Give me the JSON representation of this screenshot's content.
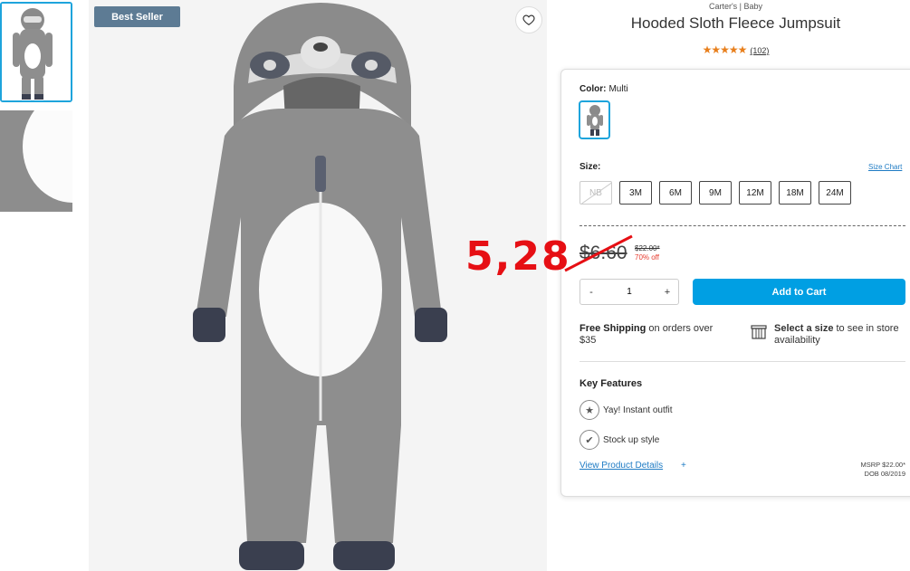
{
  "gallery": {
    "badge": "Best Seller",
    "favorite_icon": "heart-icon"
  },
  "product": {
    "brand_line": "Carter's | Baby",
    "title": "Hooded Sloth Fleece Jumpsuit",
    "stars": "★★★★★",
    "review_count": "(102)",
    "rating": 5
  },
  "color": {
    "label": "Color:",
    "value": "Multi"
  },
  "size": {
    "label": "Size:",
    "chart_link": "Size Chart",
    "options": [
      "NB",
      "3M",
      "6M",
      "9M",
      "12M",
      "18M",
      "24M"
    ],
    "unavailable": [
      "NB"
    ]
  },
  "pricing": {
    "price": "$6.60",
    "original": "$22.00*",
    "discount": "70% off",
    "annotation": "5,28",
    "annotation_color": "#e60f14"
  },
  "cart": {
    "minus": "-",
    "quantity": "1",
    "plus": "+",
    "add_label": "Add to Cart",
    "accent": "#009fe3"
  },
  "shipping": {
    "bold": "Free Shipping",
    "rest": " on orders over $35"
  },
  "store": {
    "bold": "Select a size",
    "rest": " to see in store availability"
  },
  "features": {
    "heading": "Key Features",
    "items": [
      {
        "icon": "star-badge-icon",
        "label": "Yay! Instant outfit"
      },
      {
        "icon": "checkmark-icon",
        "label": "Stock up style"
      }
    ],
    "details_link": "View Product Details",
    "details_plus": "+",
    "msrp": "MSRP $22.00*",
    "dob": "DOB 08/2019"
  }
}
